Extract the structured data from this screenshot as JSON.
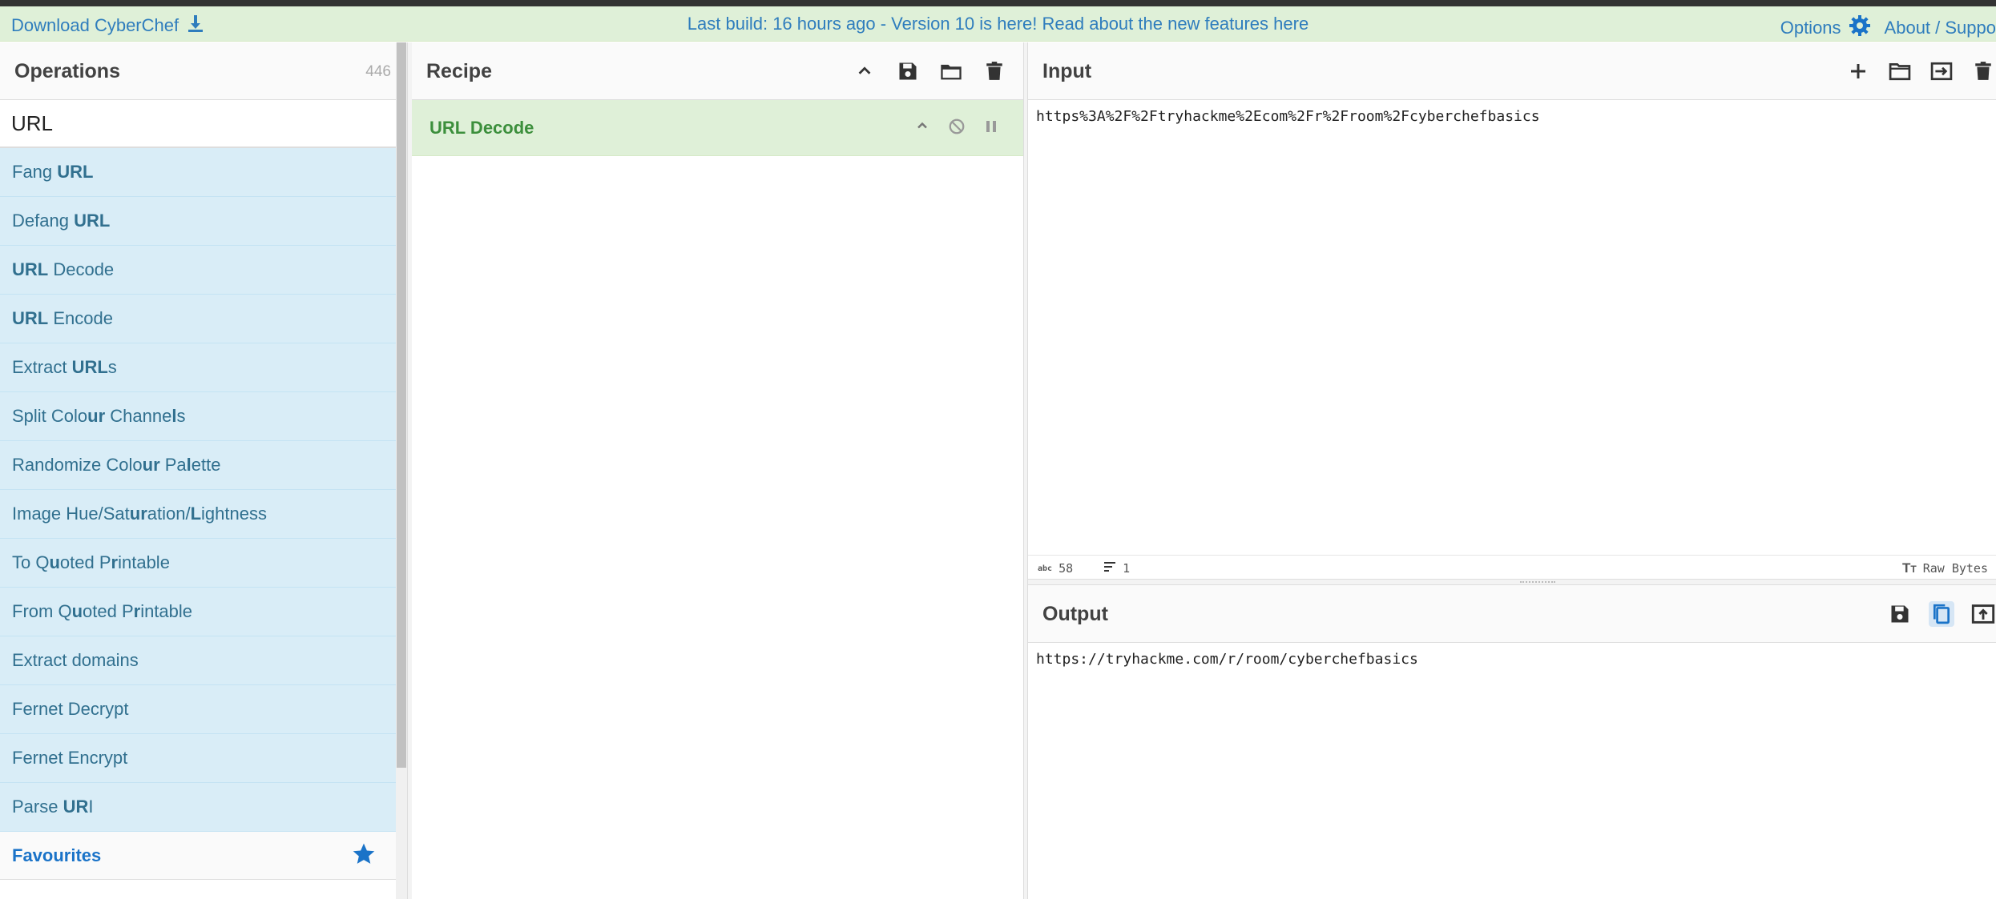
{
  "banner": {
    "download_label": "Download CyberChef",
    "notice": "Last build: 16 hours ago - Version 10 is here! Read about the new features here",
    "options_label": "Options",
    "about_label": "About / Suppo"
  },
  "operations": {
    "title": "Operations",
    "count": "446",
    "search_value": "URL",
    "items": [
      {
        "pre": "Fang ",
        "hl": "URL",
        "post": ""
      },
      {
        "pre": "Defang ",
        "hl": "URL",
        "post": ""
      },
      {
        "pre": "",
        "hl": "URL",
        "post": " Decode"
      },
      {
        "pre": "",
        "hl": "URL",
        "post": " Encode"
      },
      {
        "pre": "Extract ",
        "hl": "URL",
        "post": "s"
      },
      {
        "pre": "Split Colo",
        "hl": "ur",
        "post": " Channe",
        "hl2": "l",
        "post2": "s"
      },
      {
        "pre": "Randomize Colo",
        "hl": "ur",
        "post": " Pa",
        "hl2": "l",
        "post2": "ette"
      },
      {
        "pre": "Image Hue/Sat",
        "hl": "ur",
        "post": "ation/",
        "hl2": "L",
        "post2": "ightness"
      },
      {
        "pre": "To Q",
        "hl": "u",
        "post": "oted P",
        "hl2": "r",
        "post2": "intable"
      },
      {
        "pre": "From Q",
        "hl": "u",
        "post": "oted P",
        "hl2": "r",
        "post2": "intable"
      },
      {
        "pre": "Extract domains",
        "hl": "",
        "post": ""
      },
      {
        "pre": "Fernet Decrypt",
        "hl": "",
        "post": ""
      },
      {
        "pre": "Fernet Encrypt",
        "hl": "",
        "post": ""
      },
      {
        "pre": "Parse ",
        "hl": "UR",
        "post": "I"
      }
    ],
    "favourites_label": "Favourites"
  },
  "recipe": {
    "title": "Recipe",
    "operation_name": "URL Decode"
  },
  "input": {
    "title": "Input",
    "text": "https%3A%2F%2Ftryhackme%2Ecom%2Fr%2Froom%2Fcyberchefbasics",
    "length": "58",
    "lines": "1",
    "length_icon_label": "abc",
    "encoding_label": "Raw Bytes"
  },
  "output": {
    "title": "Output",
    "text": "https://tryhackme.com/r/room/cyberchefbasics"
  },
  "colors": {
    "banner_bg": "#dff0d8",
    "op_bg": "#d9edf7",
    "op_text": "#31708f",
    "recipe_op_bg": "#dff0d8",
    "link_blue": "#2f7dbd"
  }
}
